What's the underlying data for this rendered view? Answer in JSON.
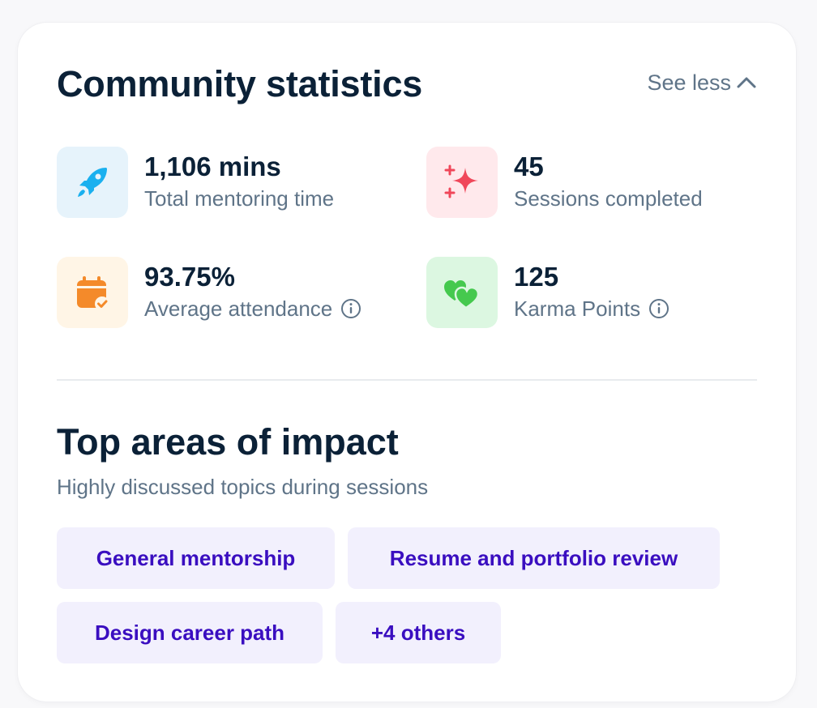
{
  "header": {
    "title": "Community statistics",
    "toggle_label": "See less",
    "toggle_icon": "chevron-up-icon"
  },
  "stats": [
    {
      "value": "1,106 mins",
      "label": "Total mentoring time",
      "icon": "rocket-icon",
      "icon_bg": "#e6f3fb",
      "icon_color": "#1ab0ef",
      "has_info": false
    },
    {
      "value": "45",
      "label": "Sessions completed",
      "icon": "sparkles-icon",
      "icon_bg": "#ffe9ec",
      "icon_color": "#f0475a",
      "has_info": false
    },
    {
      "value": "93.75%",
      "label": "Average attendance",
      "icon": "calendar-check-icon",
      "icon_bg": "#fff5e6",
      "icon_color": "#f48a2a",
      "has_info": true
    },
    {
      "value": "125",
      "label": "Karma Points",
      "icon": "hearts-icon",
      "icon_bg": "#dcf7e1",
      "icon_color": "#45c94e",
      "has_info": true
    }
  ],
  "impact": {
    "title": "Top areas of impact",
    "subtitle": "Highly discussed topics during sessions",
    "chips": [
      "General mentorship",
      "Resume and portfolio review",
      "Design career path",
      "+4 others"
    ]
  },
  "colors": {
    "text_primary": "#0b2137",
    "text_secondary": "#5f7488",
    "chip_bg": "#f2f0fd",
    "chip_text": "#3a0ec0",
    "divider": "#e8ebee"
  }
}
